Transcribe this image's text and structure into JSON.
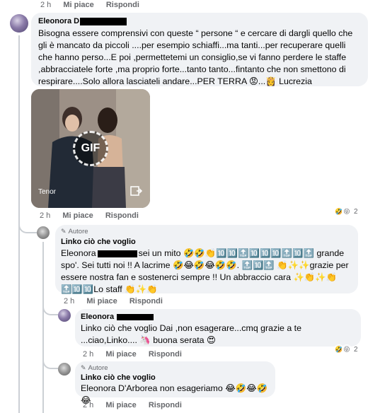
{
  "top_meta": {
    "time": "2 h",
    "like": "Mi piace",
    "reply": "Rispondi"
  },
  "comment1": {
    "author": "Eleonora D",
    "text": "Bisogna essere comprensivi con queste “ persone “ e cercare di dargli quello che gli è mancato da piccoli ....per esempio schiaffi...ma tanti...per recuperare quelli che hanno perso...E poi ,permettetemi un consiglio,se vi fanno perdere le staffe ,abbracciatele forte ,ma proprio forte...tanto tanto...fintanto che non smettono di respirare....Solo allora lasciateli andare...PER TERRA 😡...👸 Lucrezia",
    "gif_label": "GIF",
    "gif_source": "Tenor",
    "meta": {
      "time": "2 h",
      "like": "Mi piace",
      "reply": "Rispondi"
    },
    "reactions": {
      "emoji": [
        "🤣",
        "😝"
      ],
      "count": "2"
    }
  },
  "reply1": {
    "badge": "Autore",
    "author": "Linko ciò che voglio",
    "mention": "Eleonora",
    "text": "sei un mito 🤣🤣👏🔟🔟🔝🔟🔟🔟🔝🔟🔝 grande spo'. Sei tutti noi !! A lacrime 🤣😂🤣😂🤣🤣. 🔝🔟🔝 👏✨✨grazie per essere nostra fan e sostenerci sempre !! Un abbraccio cara ✨👏✨👏🔝🔟🔟Lo staff 👏✨👏",
    "meta": {
      "time": "2 h",
      "like": "Mi piace",
      "reply": "Rispondi"
    }
  },
  "reply2": {
    "author": "Eleonora",
    "mention": "Linko ciò che voglio",
    "text": "Dai ,non esagerare...cmq grazie a te ...ciao,Linko.... 🦄 buona serata 😍",
    "meta": {
      "time": "2 h",
      "like": "Mi piace",
      "reply": "Rispondi"
    },
    "reactions": {
      "emoji": [
        "🤣",
        "😝"
      ],
      "count": "2"
    }
  },
  "reply3": {
    "badge": "Autore",
    "author": "Linko ciò che voglio",
    "mention": "Eleonora D'Arborea",
    "text": "non esageriamo 😂🤣😂🤣😂",
    "meta": {
      "time": "2 h",
      "like": "Mi piace",
      "reply": "Rispondi"
    }
  },
  "colors": {
    "bubble": "#f0f2f5",
    "meta_text": "#65676b",
    "thread_line": "#ccd0d5"
  }
}
